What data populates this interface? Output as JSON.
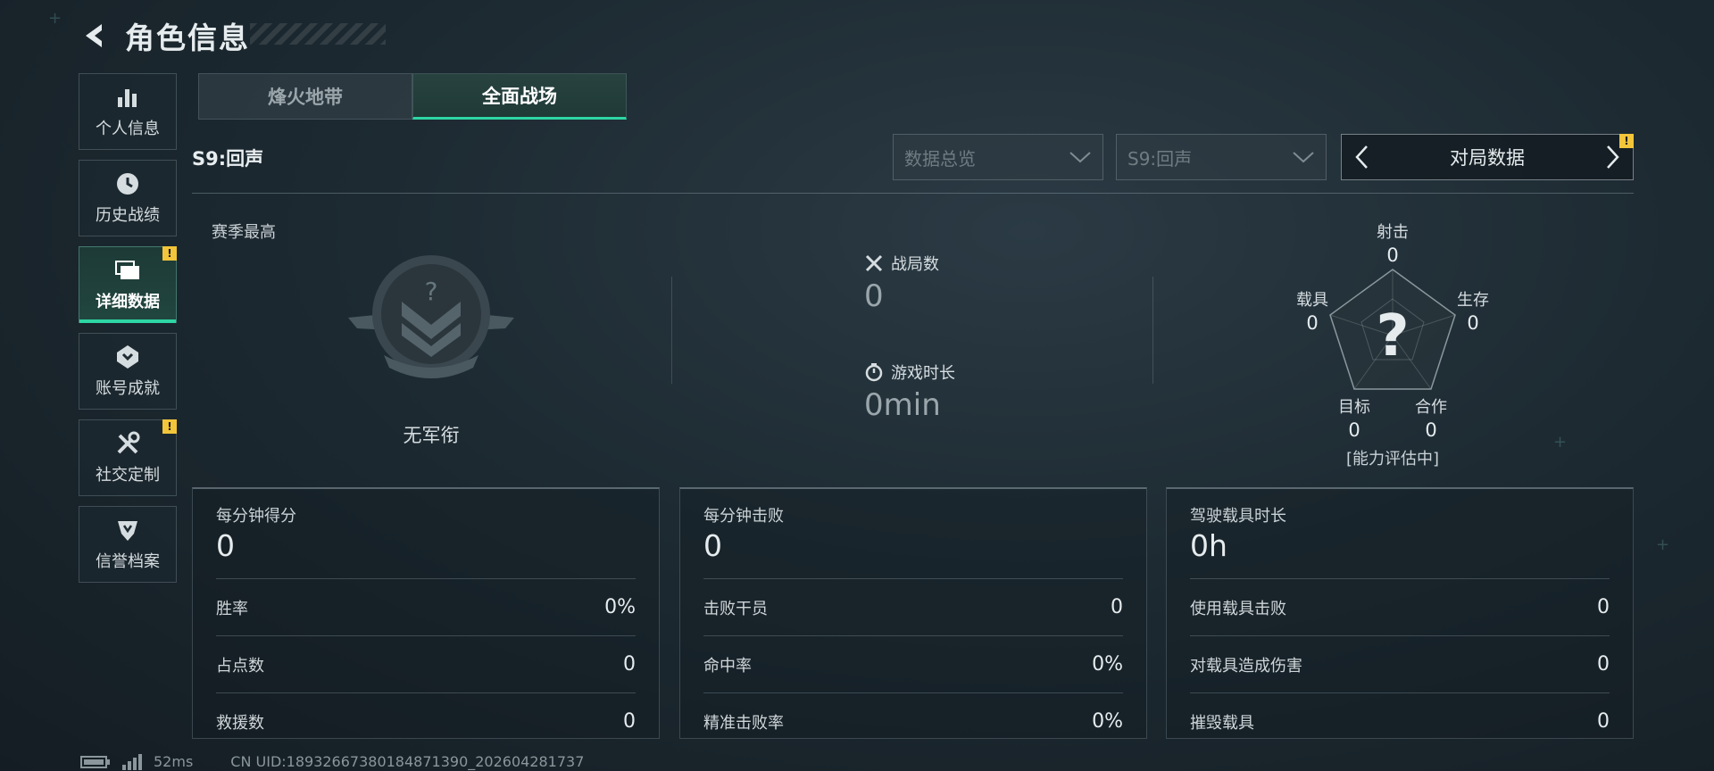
{
  "header": {
    "title": "角色信息",
    "back_icon": "back-arrow-icon"
  },
  "sidebar": {
    "items": [
      {
        "label": "个人信息",
        "icon": "bar-chart-icon",
        "active": false,
        "badge": false
      },
      {
        "label": "历史战绩",
        "icon": "history-clock-icon",
        "active": false,
        "badge": false
      },
      {
        "label": "详细数据",
        "icon": "folder-icon",
        "active": true,
        "badge": true
      },
      {
        "label": "账号成就",
        "icon": "medal-icon",
        "active": false,
        "badge": false
      },
      {
        "label": "社交定制",
        "icon": "tools-icon",
        "active": false,
        "badge": true
      },
      {
        "label": "信誉档案",
        "icon": "shield-icon",
        "active": false,
        "badge": false
      }
    ],
    "badge_text": "!"
  },
  "mode_tabs": [
    {
      "label": "烽火地带",
      "active": false
    },
    {
      "label": "全面战场",
      "active": true
    }
  ],
  "season": {
    "label": "S9:回声"
  },
  "filters": {
    "dropdown1": "数据总览",
    "dropdown2": "S9:回声",
    "switcher_label": "对局数据",
    "switcher_badge": "!"
  },
  "rank": {
    "caption": "赛季最高",
    "name": "无军衔",
    "emblem_mark": "?"
  },
  "stats": {
    "matches_label": "战局数",
    "matches_value": "0",
    "playtime_label": "游戏时长",
    "playtime_value": "0min"
  },
  "radar": {
    "center_mark": "?",
    "top": {
      "label": "射击",
      "value": "0"
    },
    "right": {
      "label": "生存",
      "value": "0"
    },
    "bottom_right": {
      "label": "合作",
      "value": "0"
    },
    "bottom_left": {
      "label": "目标",
      "value": "0"
    },
    "left": {
      "label": "载具",
      "value": "0"
    },
    "status": "[能力评估中]"
  },
  "cards": [
    {
      "head": "每分钟得分",
      "main": "0",
      "rows": [
        {
          "k": "胜率",
          "v": "0%"
        },
        {
          "k": "占点数",
          "v": "0"
        },
        {
          "k": "救援数",
          "v": "0"
        }
      ]
    },
    {
      "head": "每分钟击败",
      "main": "0",
      "rows": [
        {
          "k": "击败干员",
          "v": "0"
        },
        {
          "k": "命中率",
          "v": "0%"
        },
        {
          "k": "精准击败率",
          "v": "0%"
        }
      ]
    },
    {
      "head": "驾驶载具时长",
      "main": "0h",
      "rows": [
        {
          "k": "使用载具击败",
          "v": "0"
        },
        {
          "k": "对载具造成伤害",
          "v": "0"
        },
        {
          "k": "摧毁载具",
          "v": "0"
        }
      ]
    }
  ],
  "footer": {
    "ping": "52ms",
    "uid": "CN UID:18932667380184871390_202604281737"
  },
  "colors": {
    "accent": "#2ed6a4",
    "badge": "#f2c53a"
  }
}
